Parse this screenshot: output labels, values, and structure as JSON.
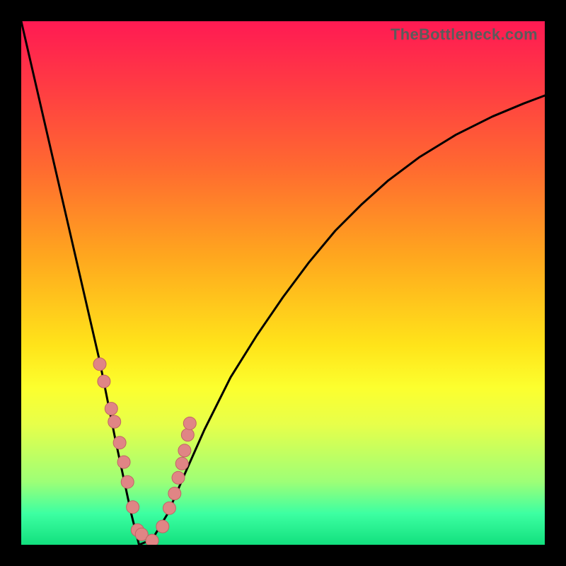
{
  "watermark": "TheBottleneck.com",
  "colors": {
    "curve": "#000000",
    "dot_fill": "#e08585",
    "dot_stroke": "#c06565"
  },
  "chart_data": {
    "type": "line",
    "title": "",
    "xlabel": "",
    "ylabel": "",
    "xlim": [
      0,
      1
    ],
    "ylim": [
      0,
      1
    ],
    "series": [
      {
        "name": "bottleneck-curve",
        "x": [
          0.0,
          0.03,
          0.06,
          0.09,
          0.12,
          0.15,
          0.18,
          0.21,
          0.225,
          0.25,
          0.28,
          0.31,
          0.35,
          0.4,
          0.45,
          0.5,
          0.55,
          0.6,
          0.65,
          0.7,
          0.76,
          0.83,
          0.9,
          0.96,
          1.0
        ],
        "y": [
          1.0,
          0.87,
          0.74,
          0.61,
          0.48,
          0.35,
          0.2,
          0.06,
          0.0,
          0.01,
          0.06,
          0.13,
          0.22,
          0.32,
          0.4,
          0.473,
          0.54,
          0.6,
          0.65,
          0.695,
          0.74,
          0.783,
          0.818,
          0.843,
          0.858
        ]
      }
    ],
    "dots": {
      "name": "highlighted-points",
      "x": [
        0.15,
        0.158,
        0.172,
        0.178,
        0.188,
        0.196,
        0.203,
        0.213,
        0.222,
        0.23,
        0.25,
        0.27,
        0.283,
        0.293,
        0.3,
        0.307,
        0.312,
        0.318,
        0.322
      ],
      "y": [
        0.345,
        0.312,
        0.26,
        0.235,
        0.195,
        0.158,
        0.12,
        0.072,
        0.028,
        0.02,
        0.008,
        0.035,
        0.07,
        0.098,
        0.128,
        0.155,
        0.18,
        0.21,
        0.232
      ]
    }
  }
}
